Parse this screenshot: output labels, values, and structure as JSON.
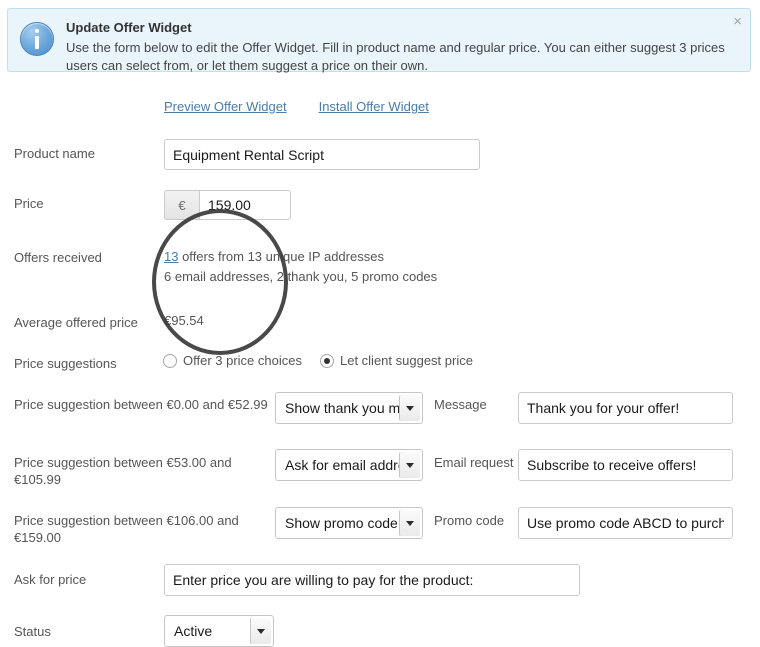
{
  "banner": {
    "icon": "info-icon",
    "title": "Update Offer Widget",
    "body": "Use the form below to edit the Offer Widget. Fill in product name and regular price. You can either suggest 3 prices users can select from, or let them suggest a price on their own.",
    "close_label": "×",
    "background": "#e9f4fb",
    "border_color": "#bfe0f1"
  },
  "top_links": [
    {
      "label": "Preview Offer Widget"
    },
    {
      "label": "Install Offer Widget"
    }
  ],
  "form": {
    "product_name": {
      "label": "Product name",
      "value": "Equipment Rental Script",
      "placeholder": ""
    },
    "price": {
      "label": "Price",
      "currency_symbol": "€",
      "value": "159.00"
    },
    "offers_received": {
      "label": "Offers received",
      "count_link": "13",
      "line1_rest": " offers from 13 unique IP addresses",
      "line2": "6 email addresses, 2 thank you, 5 promo codes"
    },
    "average_offered_price": {
      "label": "Average offered price",
      "value": "€95.54"
    },
    "price_suggestions": {
      "label": "Price suggestions",
      "options": [
        {
          "label": "Offer 3 price choices",
          "selected": false
        },
        {
          "label": "Let client suggest price",
          "selected": true
        }
      ]
    },
    "tier1": {
      "label": "Price suggestion between €0.00 and €52.99",
      "select_value": "Show thank you m",
      "side_label": "Message",
      "text_value": "Thank you for your offer!"
    },
    "tier2": {
      "label": "Price suggestion between €53.00 and €105.99",
      "select_value": "Ask for email addre",
      "side_label": "Email request",
      "text_value": "Subscribe to receive offers!"
    },
    "tier3": {
      "label": "Price suggestion between €106.00 and €159.00",
      "select_value": "Show promo code",
      "side_label": "Promo code",
      "text_value": "Use promo code ABCD to purcha"
    },
    "ask_for_price": {
      "label": "Ask for price",
      "value": "Enter price you are willing to pay for the product:"
    },
    "status": {
      "label": "Status",
      "value": "Active"
    }
  },
  "annotation": {
    "shape": "circle-highlight",
    "color": "#3a3a3a"
  }
}
